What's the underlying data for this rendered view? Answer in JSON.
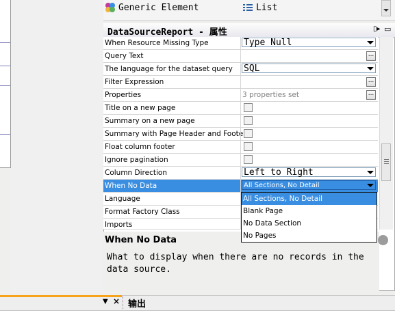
{
  "palette": {
    "items": [
      {
        "label": "Generic Element",
        "icon": "palette-element-icon"
      },
      {
        "label": "List",
        "icon": "list-icon"
      }
    ]
  },
  "properties": {
    "title": "DataSourceReport - 属性",
    "rows": [
      {
        "name": "When Resource Missing Type",
        "type": "combo",
        "value": "Type Null"
      },
      {
        "name": "Query Text",
        "type": "dots",
        "value": ""
      },
      {
        "name": "The language for the dataset query",
        "type": "combo",
        "value": "SQL"
      },
      {
        "name": "Filter Expression",
        "type": "dots",
        "value": ""
      },
      {
        "name": "Properties",
        "type": "dots",
        "value": "3 properties set"
      },
      {
        "name": "Title on a new page",
        "type": "check",
        "value": ""
      },
      {
        "name": "Summary on a new page",
        "type": "check",
        "value": ""
      },
      {
        "name": "Summary with Page Header and Footer",
        "type": "check",
        "value": ""
      },
      {
        "name": "Float column footer",
        "type": "check",
        "value": ""
      },
      {
        "name": "Ignore pagination",
        "type": "check",
        "value": ""
      },
      {
        "name": "Column Direction",
        "type": "combo",
        "value": "Left to Right"
      },
      {
        "name": "When No Data",
        "type": "combo-selected",
        "value": "All Sections, No Detail"
      },
      {
        "name": "Language",
        "type": "none",
        "value": ""
      },
      {
        "name": "Format Factory Class",
        "type": "none",
        "value": ""
      },
      {
        "name": "Imports",
        "type": "none",
        "value": ""
      }
    ]
  },
  "dropdown": {
    "options": [
      "All Sections, No Detail",
      "Blank Page",
      "No Data Section",
      "No Pages"
    ],
    "selected": "All Sections, No Detail"
  },
  "description": {
    "title": "When No Data",
    "body": "What to display when there are no records in the data source."
  },
  "bottom": {
    "output_tab": "输出"
  },
  "colors": {
    "selection": "#3a8ee2",
    "accent_tab": "#f7a21b"
  }
}
